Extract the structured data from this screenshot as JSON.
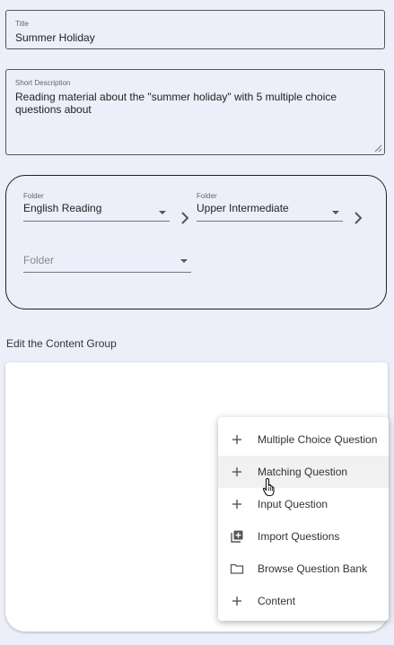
{
  "title_field": {
    "label": "Title",
    "value": "Summer Holiday"
  },
  "description_field": {
    "label": "Short Description",
    "value": "Reading material about the \"summer holiday\" with 5 multiple choice questions about"
  },
  "folders": [
    {
      "label": "Folder",
      "value": "English Reading"
    },
    {
      "label": "Folder",
      "value": "Upper Intermediate"
    },
    {
      "label": "",
      "placeholder": "Folder"
    }
  ],
  "content_group": {
    "label": "Edit the Content Group"
  },
  "menu": {
    "items": [
      {
        "icon": "plus-icon",
        "label": "Multiple Choice Question"
      },
      {
        "icon": "plus-icon",
        "label": "Matching Question"
      },
      {
        "icon": "plus-icon",
        "label": "Input Question"
      },
      {
        "icon": "library-add-icon",
        "label": "Import Questions"
      },
      {
        "icon": "folder-icon",
        "label": "Browse Question Bank"
      },
      {
        "icon": "plus-icon",
        "label": "Content"
      }
    ],
    "hovered_item": "Matching Question"
  }
}
